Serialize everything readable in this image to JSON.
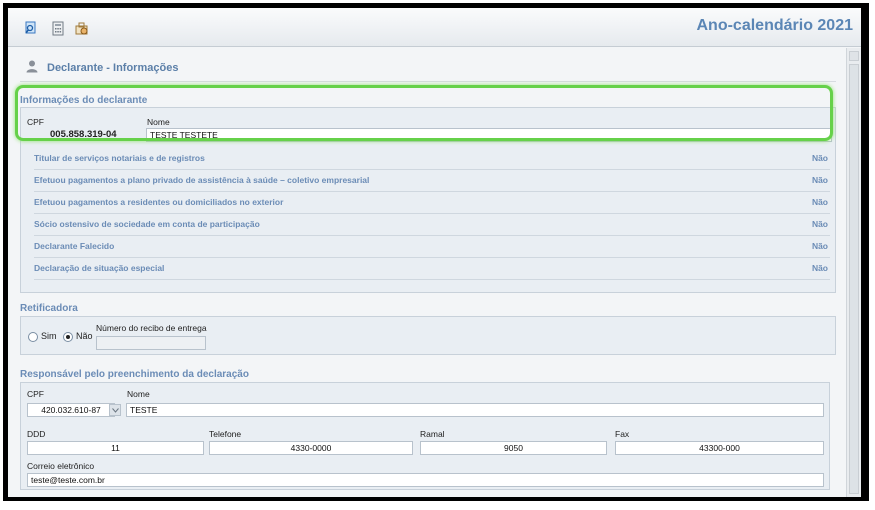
{
  "toolbar": {
    "icons": [
      "search-doc-icon",
      "calculator-icon",
      "tools-icon"
    ],
    "title": "Ano-calendário 2021"
  },
  "page": {
    "title": "Declarante - Informações"
  },
  "declarante": {
    "section_title": "Informações do declarante",
    "cpf_label": "CPF",
    "cpf_value": "005.858.319-04",
    "nome_label": "Nome",
    "nome_value": "TESTE TESTETE",
    "questions": [
      {
        "label": "Titular de serviços notariais e de registros",
        "value": "Não"
      },
      {
        "label": "Efetuou pagamentos a plano privado de assistência à saúde – coletivo empresarial",
        "value": "Não"
      },
      {
        "label": "Efetuou pagamentos a residentes ou domiciliados no exterior",
        "value": "Não"
      },
      {
        "label": "Sócio ostensivo de sociedade em conta de participação",
        "value": "Não"
      },
      {
        "label": "Declarante Falecido",
        "value": "Não"
      },
      {
        "label": "Declaração de situação especial",
        "value": "Não"
      }
    ]
  },
  "retificadora": {
    "section_title": "Retificadora",
    "option_sim": "Sim",
    "option_nao": "Não",
    "selected": "Não",
    "recibo_label": "Número do recibo de entrega",
    "recibo_value": ""
  },
  "responsavel": {
    "section_title": "Responsável pelo preenchimento da declaração",
    "cpf_label": "CPF",
    "cpf_value": "420.032.610-87",
    "nome_label": "Nome",
    "nome_value": "TESTE",
    "ddd_label": "DDD",
    "ddd_value": "11",
    "telefone_label": "Telefone",
    "telefone_value": "4330-0000",
    "ramal_label": "Ramal",
    "ramal_value": "9050",
    "fax_label": "Fax",
    "fax_value": "43300-000",
    "email_label": "Correio eletrônico",
    "email_value": "teste@teste.com.br"
  },
  "colors": {
    "accent": "#6b8cb6",
    "title": "#5b86b5",
    "highlight": "#66d14a"
  }
}
